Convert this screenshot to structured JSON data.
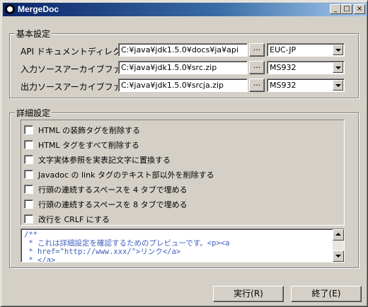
{
  "window": {
    "title": "MergeDoc"
  },
  "titlebar": {
    "minimize": "_",
    "maximize": "□",
    "close": "×"
  },
  "basic": {
    "title": "基本設定",
    "browse_label": "...",
    "rows": [
      {
        "label": "API ドキュメントディレクトリ",
        "path": "C:¥java¥jdk1.5.0¥docs¥ja¥api",
        "encoding": "EUC-JP"
      },
      {
        "label": "入力ソースアーカイブファイル",
        "path": "C:¥java¥jdk1.5.0¥src.zip",
        "encoding": "MS932"
      },
      {
        "label": "出力ソースアーカイブファイル",
        "path": "C:¥java¥jdk1.5.0¥srcja.zip",
        "encoding": "MS932"
      }
    ]
  },
  "details": {
    "title": "詳細設定",
    "options": [
      {
        "label": "HTML の装飾タグを削除する",
        "checked": false
      },
      {
        "label": "HTML タグをすべて削除する",
        "checked": false
      },
      {
        "label": "文字実体参照を実表記文字に置換する",
        "checked": false
      },
      {
        "label": "Javadoc の link タグのテキスト部以外を削除する",
        "checked": false
      },
      {
        "label": "行頭の連続するスペースを 4 タブで埋める",
        "checked": false
      },
      {
        "label": "行頭の連続するスペースを 8 タブで埋める",
        "checked": false
      },
      {
        "label": "改行を CRLF にする",
        "checked": false
      }
    ],
    "preview_lines": [
      "/**",
      " * これは詳細設定を確認するためのプレビューです。<p><a",
      " * href=\"http://www.xxx/\">リンク</a>",
      " * </a>"
    ]
  },
  "footer": {
    "run_label": "実行(R)",
    "exit_label": "終了(E)"
  }
}
